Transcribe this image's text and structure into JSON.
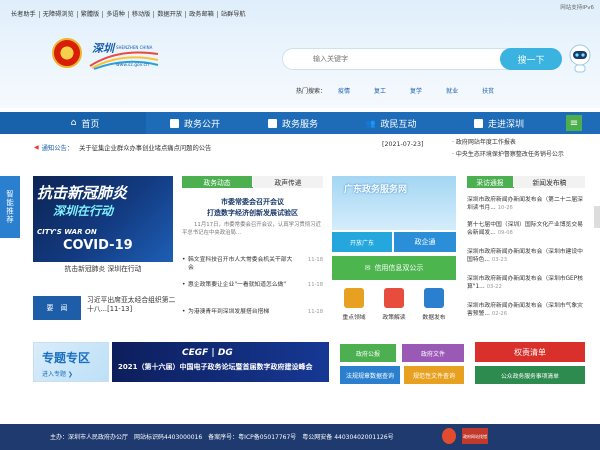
{
  "topbar": {
    "links": [
      "长者助手",
      "无障碍浏览",
      "繁體版",
      "多语种",
      "移动版",
      "数据开放",
      "政务邮箱",
      "站群导航"
    ],
    "ipv6": "网站支持IPv6"
  },
  "logo": {
    "title": "深圳",
    "sub": "SHENZHEN CHINA",
    "url": "www.sz.gov.cn"
  },
  "search": {
    "placeholder": "输入关键字",
    "button": "搜一下"
  },
  "hot": {
    "label": "热门搜索：",
    "items": [
      "疫情",
      "复工",
      "复学",
      "就业",
      "扶贫"
    ]
  },
  "nav": {
    "items": [
      "首页",
      "政务公开",
      "政务服务",
      "政民互动",
      "走进深圳"
    ],
    "menu": "≡"
  },
  "notice": {
    "label": "通知公告：",
    "text": "关于征集企业群众办事创业堵点痛点问题的公告",
    "date": "[2021-07-23]"
  },
  "side_news": [
    "政府网站年度工作报表",
    "中央生态环境保护督察整改任务销号公示"
  ],
  "smart": "智能推荐",
  "banner": {
    "top": "抗击新冠肺炎",
    "mid": "深圳在行动",
    "war": "CITY'S WAR ON",
    "covid": "COVID-19",
    "caption": "抗击新冠肺炎 深圳在行动"
  },
  "yaowen": {
    "label": "要　闻",
    "text": "习近平出席亚太经合组织第二十八...[11-13]"
  },
  "news_tabs": [
    "政务动态",
    "政声传递"
  ],
  "headline": {
    "title1": "市委常委会召开会议",
    "title2": "打造数字经济创新发展试验区",
    "summary": "11月17日，市委常委会召开会议，认真学习贯彻习近平总书记在中央政治局..."
  },
  "news": [
    {
      "text": "韩文宣科技召开市人大常委会机关干部大会",
      "date": "11-18"
    },
    {
      "text": "惠企政策要让企业\"一看就知道怎么做\"",
      "date": "11-18"
    },
    {
      "text": "为港澳青年到深圳发展搭台搭梯",
      "date": "11-18"
    }
  ],
  "gdapp": {
    "title": "广东政务服务网",
    "btn1": "开放广东",
    "btn2": "政企通"
  },
  "xinxi": "信用信息双公示",
  "services": [
    {
      "label": "重点领域",
      "color": "#e8a020"
    },
    {
      "label": "政策解读",
      "color": "#e84c3d"
    },
    {
      "label": "数据发布",
      "color": "#2a7fcf"
    }
  ],
  "rnews_tabs": [
    "采访通报",
    "新闻发布稿"
  ],
  "rnews": [
    {
      "text": "深圳市政府新闻办新闻发布会（第二十二届深圳读书月...",
      "date": "10-26"
    },
    {
      "text": "第十七届中国（深圳）国际文化产业博览交易会新闻发...",
      "date": "09-08"
    },
    {
      "text": "深圳市政府新闻办新闻发布会（深圳市建设中国特色...",
      "date": "03-23"
    },
    {
      "text": "深圳市政府新闻办新闻发布会（深圳市GEP核算\"1...",
      "date": "03-22"
    },
    {
      "text": "深圳市政府新闻办新闻发布会（深圳市气象灾害预警...",
      "date": "02-26"
    }
  ],
  "zhuanti": {
    "title": "专题专区",
    "link": "进入专题 ❯"
  },
  "forum": {
    "logo": "CEGF | DG",
    "text": "2021（第十六届）中国电子政务论坛暨首届数字政府建设峰会"
  },
  "gov_buttons": [
    "政府公报",
    "政府文件",
    "法规规章数据查询",
    "规范性文件查询"
  ],
  "qzqd": "权责清单",
  "gzh": "公众政务服务事项清单",
  "footer": {
    "text": "主办：深圳市人民政府办公厅　网站标识码4403000016　备案序号：粤ICP备05017767号　粤公网安备 44030402001126号",
    "badge": "政府网站找错"
  }
}
